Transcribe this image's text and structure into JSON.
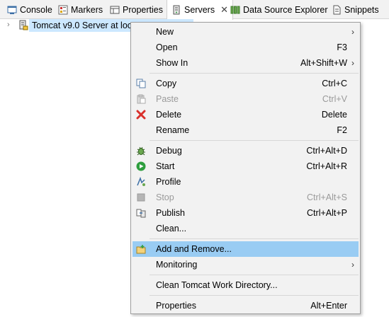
{
  "tabs": [
    {
      "label": "Console",
      "icon": "console-icon"
    },
    {
      "label": "Markers",
      "icon": "markers-icon"
    },
    {
      "label": "Properties",
      "icon": "properties-icon"
    },
    {
      "label": "Servers",
      "icon": "servers-icon",
      "active": true
    },
    {
      "label": "Data Source Explorer",
      "icon": "data-source-icon"
    },
    {
      "label": "Snippets",
      "icon": "snippets-icon"
    }
  ],
  "tree": {
    "server_label": "Tomcat v9.0 Server at loc"
  },
  "menu": {
    "new": {
      "label": "New",
      "has_submenu": true
    },
    "open": {
      "label": "Open",
      "accel": "F3"
    },
    "show_in": {
      "label": "Show In",
      "accel": "Alt+Shift+W",
      "has_submenu": true
    },
    "copy": {
      "label": "Copy",
      "accel": "Ctrl+C"
    },
    "paste": {
      "label": "Paste",
      "accel": "Ctrl+V",
      "disabled": true
    },
    "delete": {
      "label": "Delete",
      "accel": "Delete"
    },
    "rename": {
      "label": "Rename",
      "accel": "F2"
    },
    "debug": {
      "label": "Debug",
      "accel": "Ctrl+Alt+D"
    },
    "start": {
      "label": "Start",
      "accel": "Ctrl+Alt+R"
    },
    "profile": {
      "label": "Profile"
    },
    "stop": {
      "label": "Stop",
      "accel": "Ctrl+Alt+S",
      "disabled": true
    },
    "publish": {
      "label": "Publish",
      "accel": "Ctrl+Alt+P"
    },
    "clean": {
      "label": "Clean..."
    },
    "add_remove": {
      "label": "Add and Remove...",
      "highlighted": true
    },
    "monitoring": {
      "label": "Monitoring",
      "has_submenu": true
    },
    "clean_work_dir": {
      "label": "Clean Tomcat Work Directory..."
    },
    "properties": {
      "label": "Properties",
      "accel": "Alt+Enter"
    }
  },
  "glyphs": {
    "submenu_arrow": "›",
    "twisty": "›",
    "close": "✕"
  },
  "colors": {
    "selection": "#cce8ff",
    "menu_highlight": "#99ccf3",
    "menu_bg": "#f2f2f2",
    "disabled_text": "#9a9a9a",
    "delete_red": "#d9302b",
    "start_green": "#2e9e3e"
  }
}
